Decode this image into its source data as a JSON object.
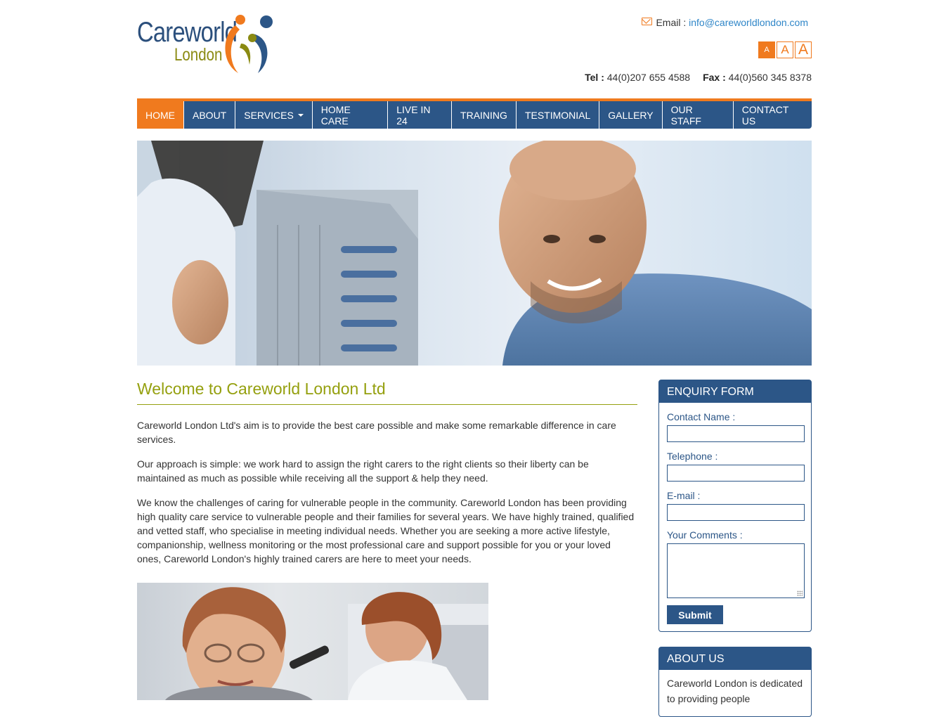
{
  "header": {
    "logo_line1": "Careworld",
    "logo_line2": "London",
    "email_label": "Email : ",
    "email_value": "info@careworldlondon.com",
    "font_sizes": [
      "A",
      "A",
      "A"
    ],
    "tel_label": "Tel : ",
    "tel_value": "44(0)207 655 4588",
    "fax_label": "Fax : ",
    "fax_value": "44(0)560 345 8378"
  },
  "nav": {
    "items": [
      "HOME",
      "ABOUT",
      "SERVICES",
      "HOME CARE",
      "LIVE IN 24",
      "TRAINING",
      "TESTIMONIAL",
      "GALLERY",
      "OUR STAFF",
      "CONTACT US"
    ],
    "active": "HOME"
  },
  "main": {
    "title": "Welcome to Careworld London Ltd",
    "paragraphs": [
      "Careworld London Ltd's aim is to provide the best care possible and make some remarkable difference in care services.",
      "Our approach is simple: we work hard to assign the right carers to the right clients so their liberty can be maintained as much as possible while receiving all the support & help they need.",
      "We know the challenges of caring for vulnerable people in the community. Careworld London has been providing high quality care service to vulnerable people and their families for several years. We have highly trained, qualified and vetted staff, who specialise in meeting individual needs. Whether you are seeking a more active lifestyle, companionship, wellness monitoring or the most professional care and support possible for you or your loved ones, Careworld London's highly trained carers are here to meet your needs."
    ]
  },
  "enquiry": {
    "title": "ENQUIRY FORM",
    "contact_name_label": "Contact Name :",
    "telephone_label": "Telephone :",
    "email_label": "E-mail :",
    "comments_label": "Your Comments :",
    "submit_label": "Submit"
  },
  "about": {
    "title": "ABOUT US",
    "text": "Careworld London is dedicated to providing people"
  },
  "colors": {
    "brand_blue": "#2c5687",
    "accent_orange": "#f07a1e",
    "title_olive": "#95a00f",
    "link_blue": "#2f86c8"
  }
}
